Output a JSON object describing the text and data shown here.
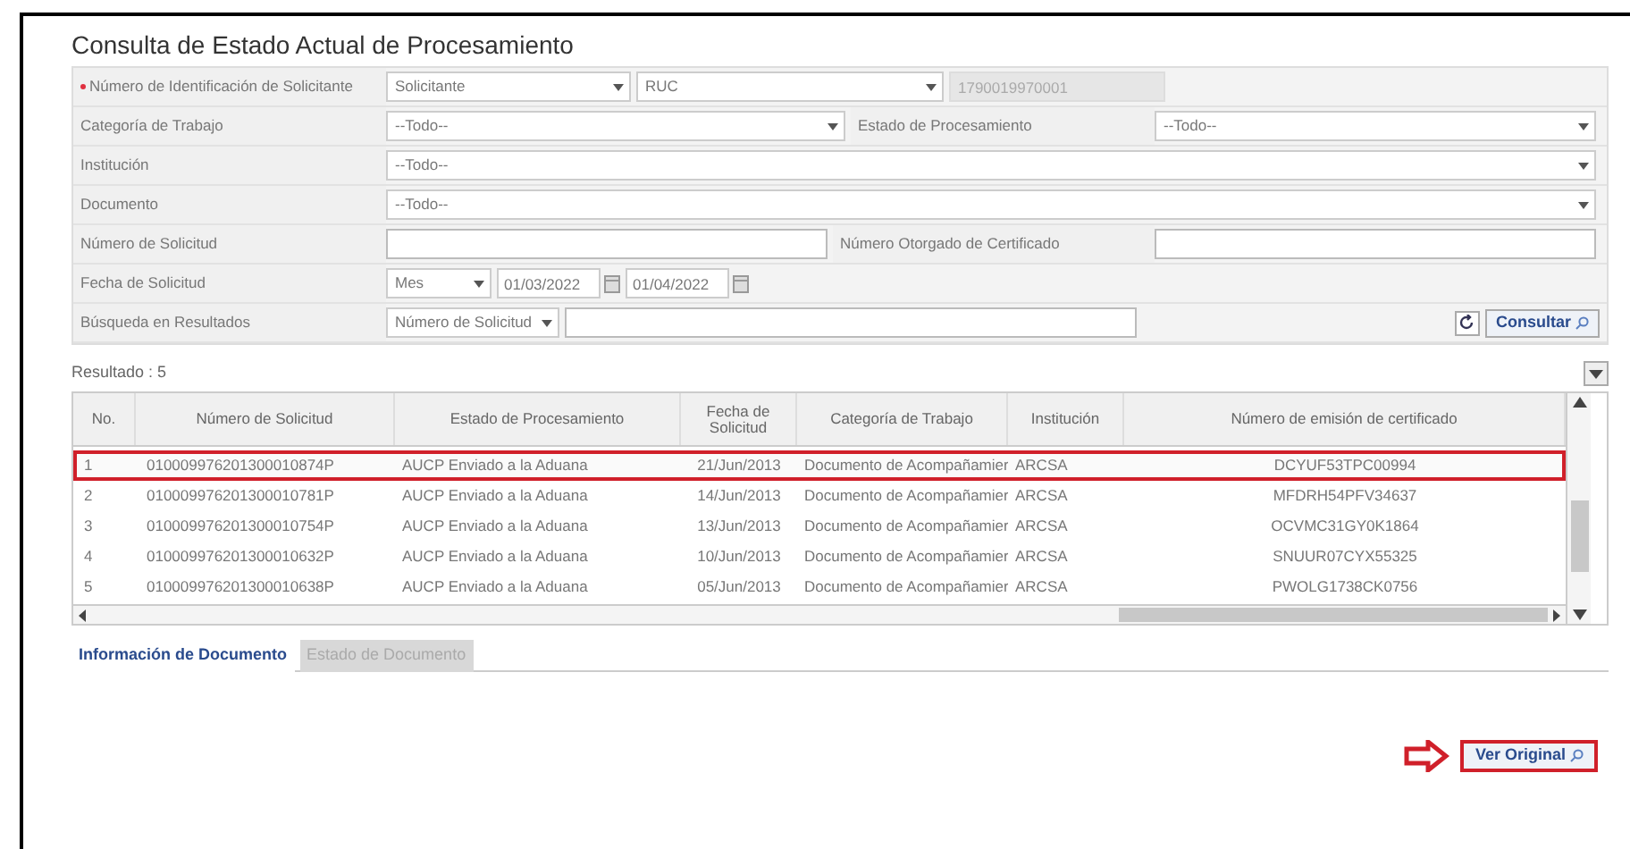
{
  "title": "Consulta de Estado Actual de Procesamiento",
  "form": [
    {
      "cells": [
        {
          "kind": "label",
          "text": "Número de Identificación de Solicitante",
          "required": true
        },
        {
          "kind": "select",
          "value": "Solicitante"
        },
        {
          "kind": "select",
          "value": "RUC"
        },
        {
          "kind": "input",
          "value": "1790019970001",
          "disabled": true
        }
      ]
    },
    {
      "cells": [
        {
          "kind": "label",
          "text": "Categoría de Trabajo",
          "required": false
        },
        {
          "kind": "select",
          "value": "--Todo--"
        },
        {
          "kind": "label",
          "text": "Estado de Procesamiento",
          "required": false
        },
        {
          "kind": "select",
          "value": "--Todo--"
        }
      ]
    },
    {
      "cells": [
        {
          "kind": "label",
          "text": "Institución",
          "required": false
        },
        {
          "kind": "select",
          "value": "--Todo--"
        }
      ]
    },
    {
      "cells": [
        {
          "kind": "label",
          "text": "Documento",
          "required": false
        },
        {
          "kind": "select",
          "value": "--Todo--"
        }
      ]
    },
    {
      "cells": [
        {
          "kind": "label",
          "text": "Número de Solicitud",
          "required": false
        },
        {
          "kind": "input",
          "disabled": false
        },
        {
          "kind": "label",
          "text": "Número Otorgado de Certificado",
          "required": false
        },
        {
          "kind": "input",
          "disabled": false
        }
      ]
    },
    {
      "cells": [
        {
          "kind": "label",
          "text": "Fecha de Solicitud",
          "required": false
        },
        {
          "kind": "select",
          "value": "Mes"
        },
        {
          "kind": "date",
          "value": "01/03/2022"
        },
        {
          "kind": "date",
          "value": "01/04/2022"
        }
      ]
    },
    {
      "cells": [
        {
          "kind": "label",
          "text": "Búsqueda en Resultados",
          "required": false
        },
        {
          "kind": "select",
          "value": "Número de Solicitud"
        },
        {
          "kind": "input",
          "disabled": false
        }
      ]
    }
  ],
  "search_button": "Consultar",
  "result_count": "Resultado : 5",
  "table": {
    "columns": [
      "No.",
      "Número de Solicitud",
      "Estado de Procesamiento",
      "Fecha de Solicitud",
      "Categoría de Trabajo",
      "Institución",
      "Número de emisión de certificado"
    ],
    "rows": [
      {
        "selected": true,
        "cells": [
          "1",
          "010009976201300010874P",
          "AUCP Enviado a la Aduana",
          "21/Jun/2013",
          "Documento de Acompañamier",
          "ARCSA",
          "DCYUF53TPC00994"
        ]
      },
      {
        "selected": false,
        "cells": [
          "2",
          "010009976201300010781P",
          "AUCP Enviado a la Aduana",
          "14/Jun/2013",
          "Documento de Acompañamier",
          "ARCSA",
          "MFDRH54PFV34637"
        ]
      },
      {
        "selected": false,
        "cells": [
          "3",
          "010009976201300010754P",
          "AUCP Enviado a la Aduana",
          "13/Jun/2013",
          "Documento de Acompañamier",
          "ARCSA",
          "OCVMC31GY0K1864"
        ]
      },
      {
        "selected": false,
        "cells": [
          "4",
          "010009976201300010632P",
          "AUCP Enviado a la Aduana",
          "10/Jun/2013",
          "Documento de Acompañamier",
          "ARCSA",
          "SNUUR07CYX55325"
        ]
      },
      {
        "selected": false,
        "cells": [
          "5",
          "010009976201300010638P",
          "AUCP Enviado a la Aduana",
          "05/Jun/2013",
          "Documento de Acompañamier",
          "ARCSA",
          "PWOLG1738CK0756"
        ]
      }
    ]
  },
  "tabs": [
    {
      "label": "Información de Documento",
      "selected": true
    },
    {
      "label": "Estado de Documento",
      "selected": false
    }
  ],
  "original_button": "Ver Original"
}
